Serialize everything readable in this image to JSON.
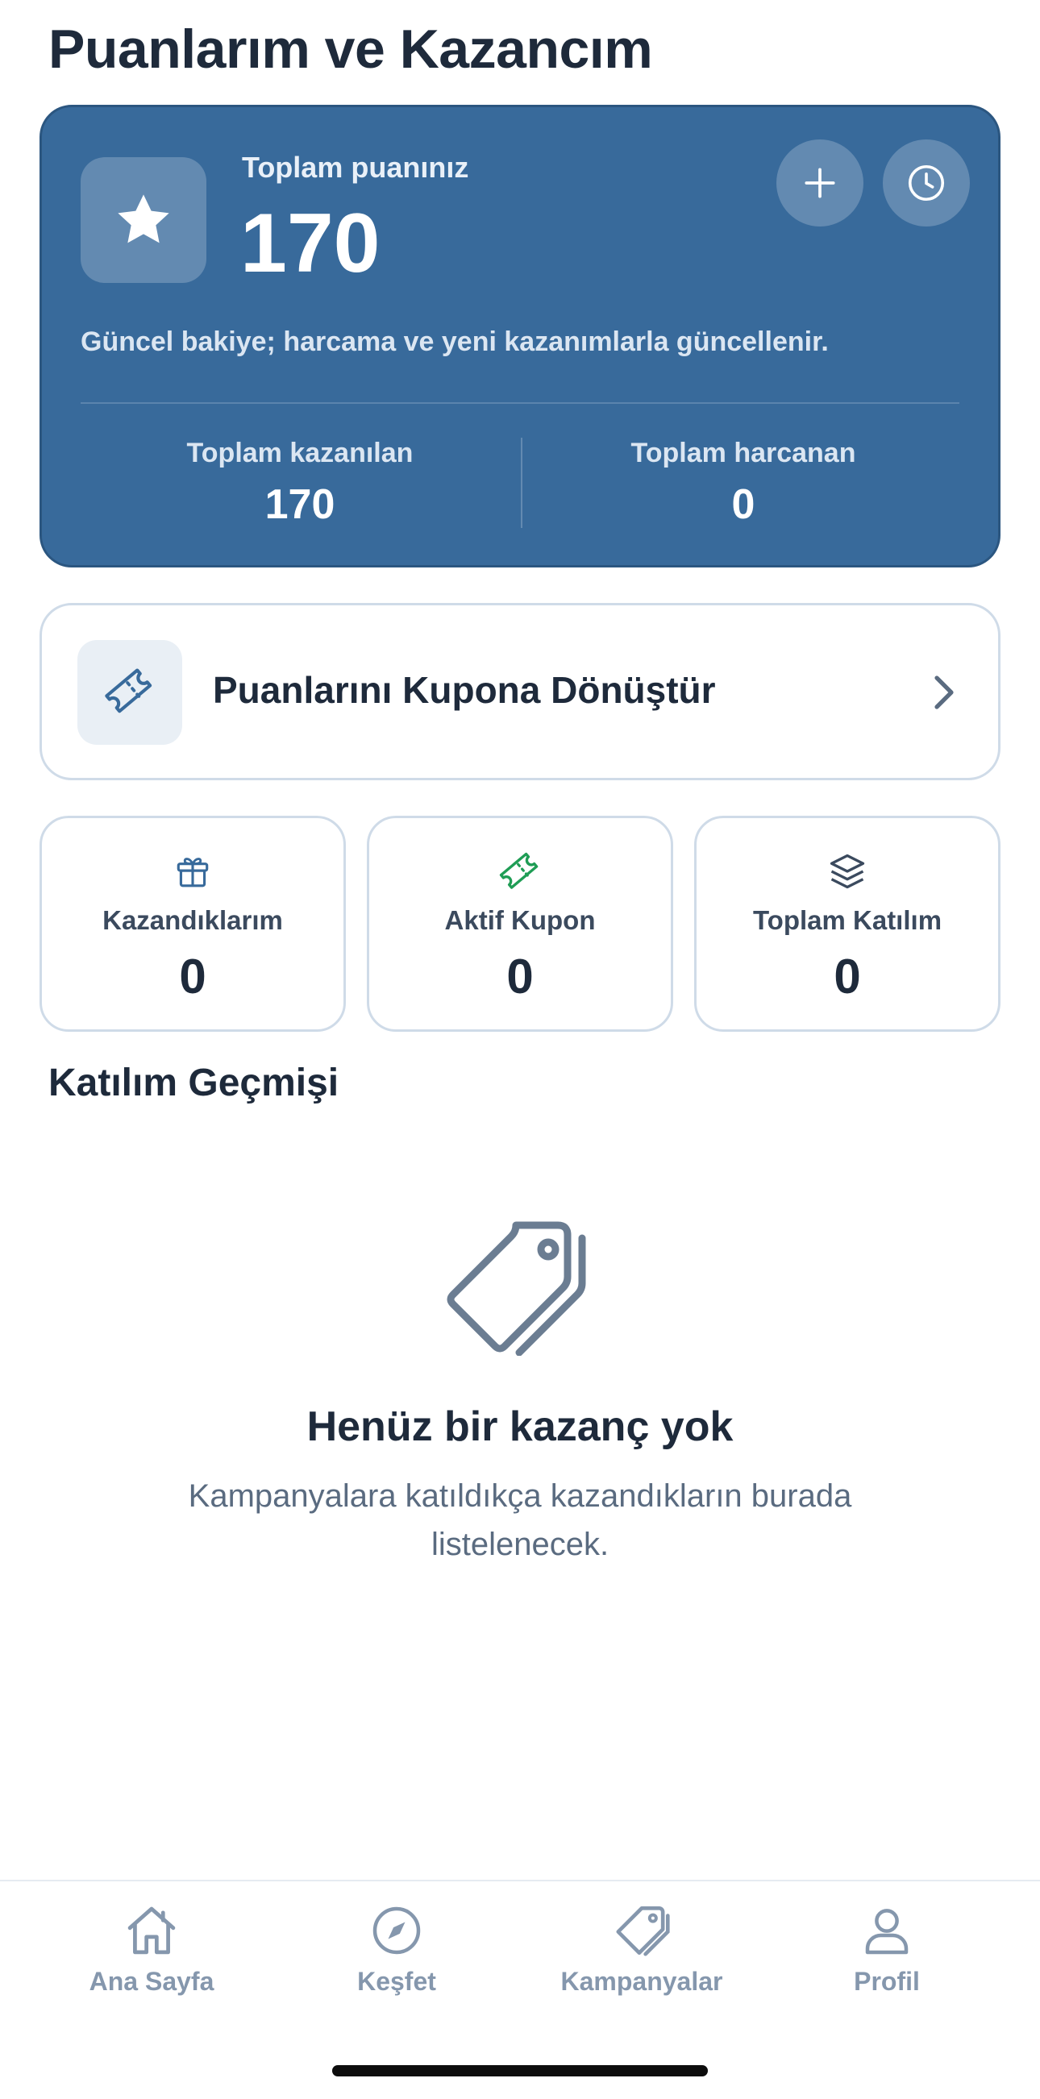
{
  "page": {
    "title": "Puanlarım ve Kazancım"
  },
  "balance": {
    "label": "Toplam puanınız",
    "value": "170",
    "description": "Güncel bakiye; harcama ve yeni kazanımlarla güncellenir.",
    "earned_label": "Toplam kazanılan",
    "earned_value": "170",
    "spent_label": "Toplam harcanan",
    "spent_value": "0",
    "icons": {
      "badge": "star-icon",
      "add": "plus-icon",
      "history": "clock-icon"
    },
    "colors": {
      "background": "#386a9b"
    }
  },
  "convert": {
    "label": "Puanlarını Kupona Dönüştür",
    "icon": "ticket-icon"
  },
  "stats": [
    {
      "label": "Kazandıklarım",
      "value": "0",
      "icon": "gift-icon",
      "color": "#386a9b"
    },
    {
      "label": "Aktif Kupon",
      "value": "0",
      "icon": "ticket-icon",
      "color": "#1f9d55"
    },
    {
      "label": "Toplam Katılım",
      "value": "0",
      "icon": "layers-icon",
      "color": "#3b4a5e"
    }
  ],
  "history": {
    "title": "Katılım Geçmişi",
    "empty_title": "Henüz bir kazanç yok",
    "empty_description": "Kampanyalara katıldıkça kazandıkların burada listelenecek.",
    "empty_icon": "tags-icon"
  },
  "tabbar": {
    "items": [
      {
        "label": "Ana Sayfa",
        "icon": "home-icon"
      },
      {
        "label": "Keşfet",
        "icon": "compass-icon"
      },
      {
        "label": "Kampanyalar",
        "icon": "tag-icon"
      },
      {
        "label": "Profil",
        "icon": "person-icon"
      }
    ]
  }
}
